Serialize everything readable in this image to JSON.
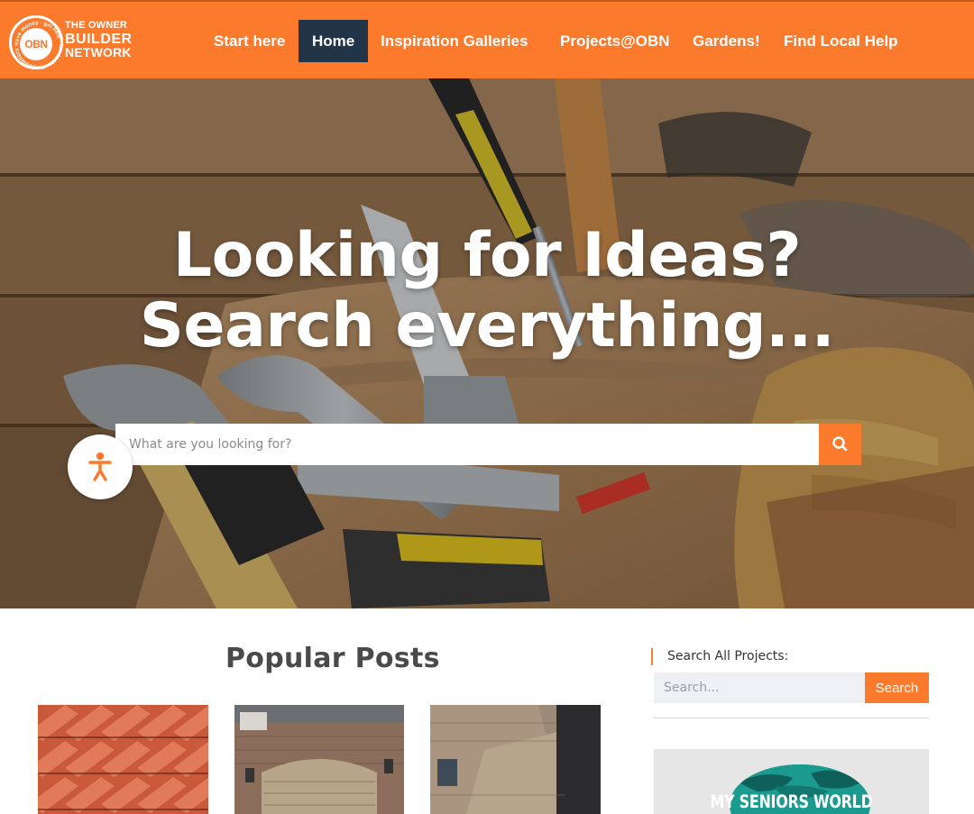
{
  "brand": {
    "logo_abbrev": "OBN",
    "logo_line1": "THE OWNER",
    "logo_line2": "BUILDER",
    "logo_line3": "NETWORK",
    "logo_ring_text": "save money · get help · fun tools · homeowners ·",
    "primary_color": "#fb7a2c",
    "active_nav_color": "#223548"
  },
  "nav": {
    "items": [
      {
        "label": "Start here"
      },
      {
        "label": "Home",
        "active": true
      },
      {
        "label": "Inspiration Galleries"
      },
      {
        "label": "Projects@OBN"
      },
      {
        "label": "Gardens!"
      },
      {
        "label": "Find Local Help"
      }
    ]
  },
  "hero": {
    "title_line1": "Looking for Ideas?",
    "title_line2": "Search everything...",
    "search_placeholder": "What are you looking for?",
    "search_icon": "search-icon",
    "accessibility_icon": "accessibility-person-icon"
  },
  "main": {
    "section_title": "Popular Posts",
    "posts": [
      {
        "image": "terracotta-roof-tiles"
      },
      {
        "image": "brick-house-garage-door"
      },
      {
        "image": "stone-house-exterior"
      }
    ]
  },
  "sidebar": {
    "search_label": "Search All Projects:",
    "search_placeholder": "Search...",
    "search_button": "Search",
    "ad_text": "MY SENIORS WORLD"
  }
}
